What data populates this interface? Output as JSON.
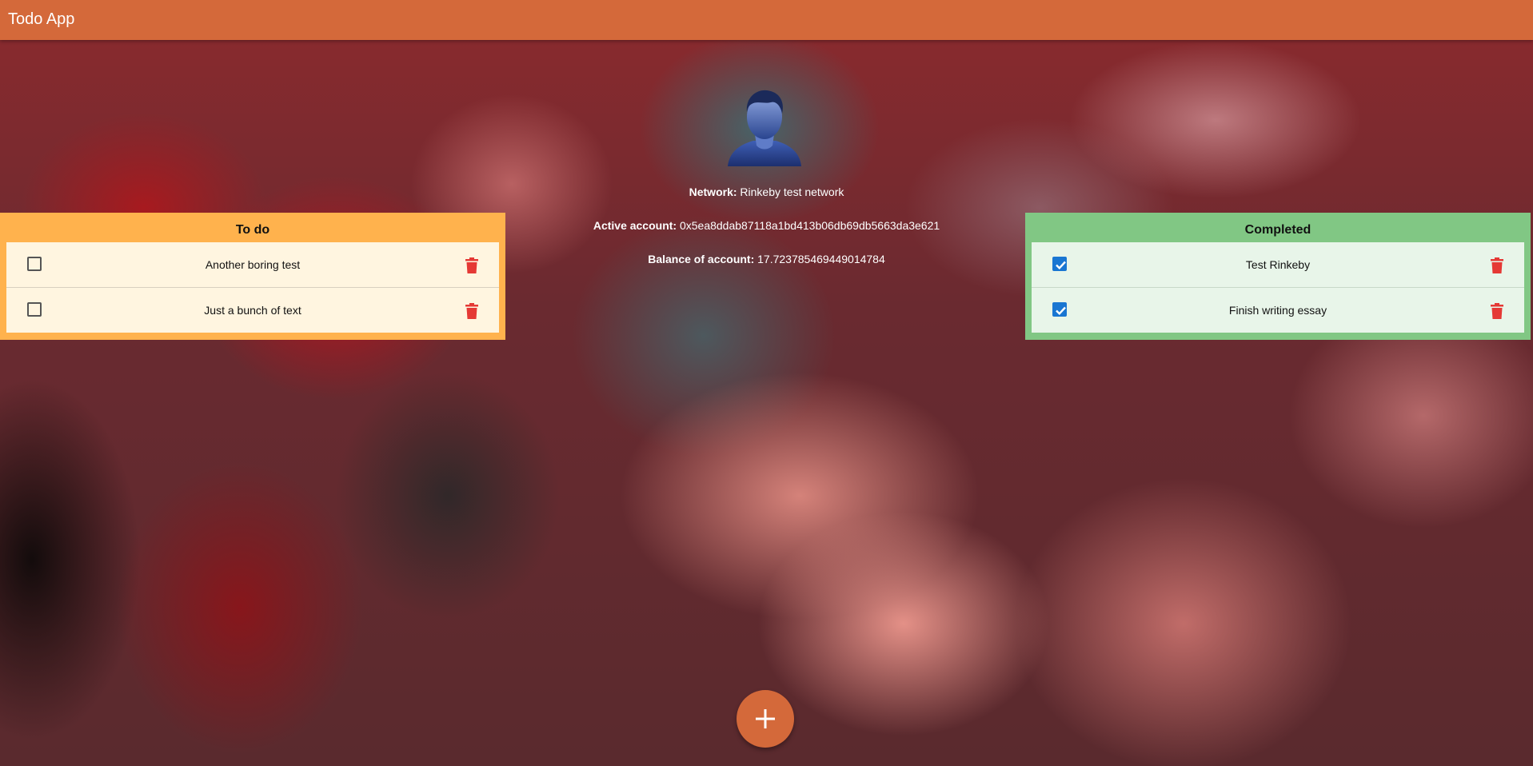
{
  "app_bar": {
    "title": "Todo App",
    "color": "#d4693a"
  },
  "profile": {
    "avatar_icon": "user-avatar-icon",
    "network_label": "Network:",
    "network_value": "Rinkeby test network",
    "account_label": "Active account:",
    "account_value": "0x5ea8ddab87118a1bd413b06db69db5663da3e621",
    "balance_label": "Balance of account:",
    "balance_value": "17.723785469449014784"
  },
  "todo": {
    "title": "To do",
    "color": "#ffb24d",
    "items": [
      {
        "text": "Another boring test",
        "checked": false
      },
      {
        "text": "Just a bunch of text",
        "checked": false
      }
    ]
  },
  "completed": {
    "title": "Completed",
    "color": "#81c784",
    "items": [
      {
        "text": "Test Rinkeby",
        "checked": true
      },
      {
        "text": "Finish writing essay",
        "checked": true
      }
    ]
  },
  "fab": {
    "icon": "plus-icon"
  }
}
